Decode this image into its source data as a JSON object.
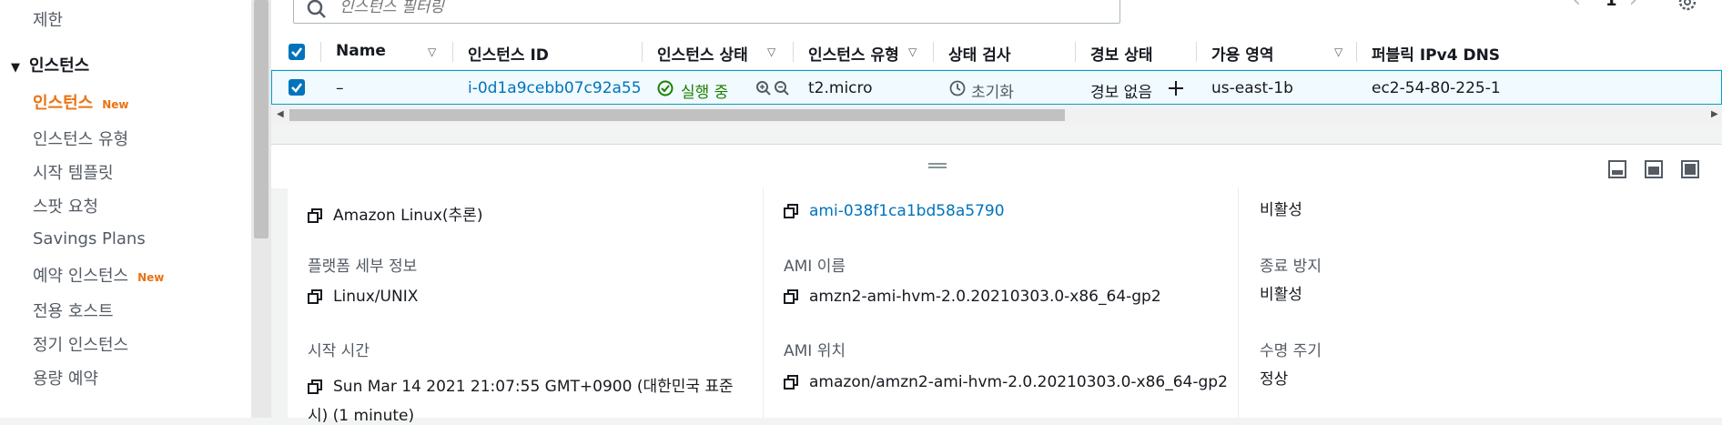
{
  "sidebar": {
    "items_top": {
      "limits": "제한"
    },
    "section": "인스턴스",
    "items": [
      {
        "label": "인스턴스",
        "badge": "New",
        "active": true
      },
      {
        "label": "인스턴스 유형"
      },
      {
        "label": "시작 템플릿"
      },
      {
        "label": "스팟 요청"
      },
      {
        "label": "Savings Plans"
      },
      {
        "label": "예약 인스턴스",
        "badge": "New"
      },
      {
        "label": "전용 호스트"
      },
      {
        "label": "정기 인스턴스"
      },
      {
        "label": "용량 예약"
      }
    ]
  },
  "filter": {
    "placeholder": "인스턴스 필터링"
  },
  "pager": {
    "prev": "‹",
    "page": "1",
    "next": "›"
  },
  "table": {
    "headers": {
      "name": "Name",
      "instance_id": "인스턴스 ID",
      "state": "인스턴스 상태",
      "type": "인스턴스 유형",
      "status_check": "상태 검사",
      "alarm": "경보 상태",
      "az": "가용 영역",
      "dns": "퍼블릭 IPv4 DNS"
    },
    "row": {
      "name": "–",
      "instance_id": "i-0d1a9cebb07c92a55",
      "state": "실행 중",
      "type": "t2.micro",
      "status_check": "초기화",
      "alarm": "경보 없음",
      "az": "us-east-1b",
      "dns": "ec2-54-80-225-1"
    }
  },
  "details": {
    "col1": {
      "platform_value": "Amazon Linux(추론)",
      "platform_detail_label": "플랫폼 세부 정보",
      "platform_detail_value": "Linux/UNIX",
      "launch_time_label": "시작 시간",
      "launch_time_value_1": "Sun Mar 14 2021 21:07:55 GMT+0900 (대한민국 표준",
      "launch_time_value_2": "시) (1 minute)"
    },
    "col2": {
      "ami_id_value": "ami-038f1ca1bd58a5790",
      "ami_name_label": "AMI 이름",
      "ami_name_value": "amzn2-ami-hvm-2.0.20210303.0-x86_64-gp2",
      "ami_location_label": "AMI 위치",
      "ami_location_value": "amazon/amzn2-ami-hvm-2.0.20210303.0-x86_64-gp2"
    },
    "col3": {
      "top_value": "비활성",
      "termination_label": "종료 방지",
      "termination_value": "비활성",
      "lifecycle_label": "수명 주기",
      "lifecycle_value": "정상"
    }
  },
  "colors": {
    "accent": "#ec7211",
    "link": "#0073bb",
    "success": "#1d8102",
    "selected_row": "#f1faff"
  }
}
